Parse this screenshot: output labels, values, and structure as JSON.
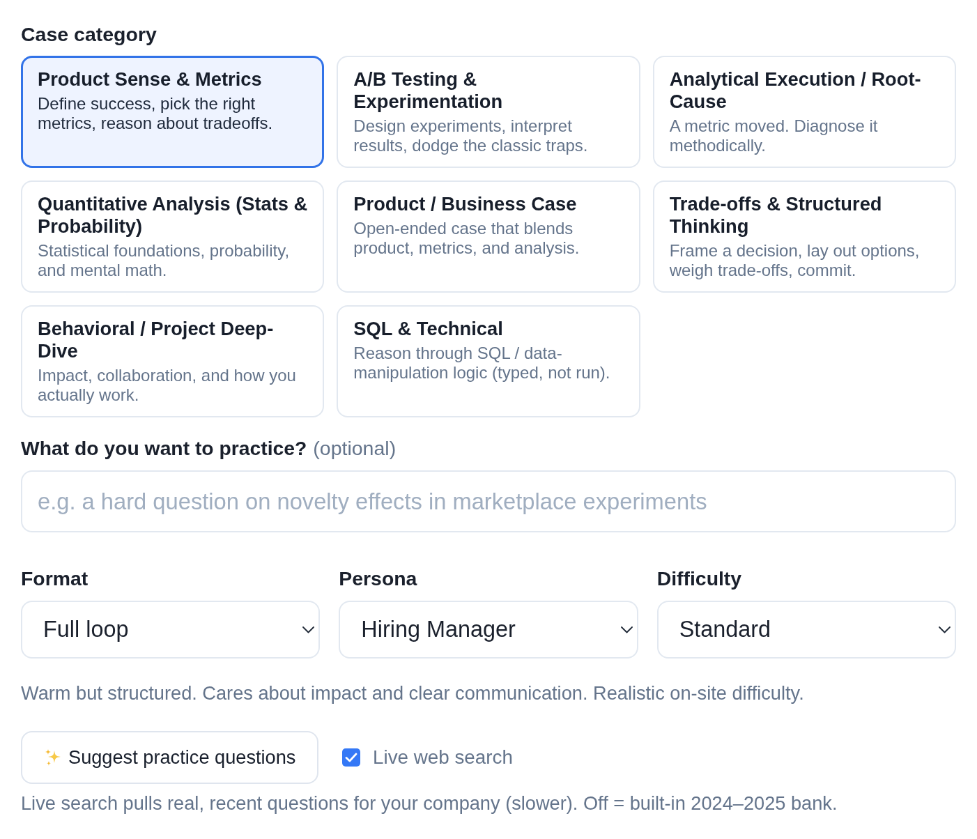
{
  "case_category": {
    "label": "Case category",
    "cards": [
      {
        "title": "Product Sense & Metrics",
        "description": "Define success, pick the right metrics, reason about tradeoffs.",
        "selected": true
      },
      {
        "title": "A/B Testing & Experimentation",
        "description": "Design experiments, interpret results, dodge the classic traps.",
        "selected": false
      },
      {
        "title": "Analytical Execution / Root-Cause",
        "description": "A metric moved. Diagnose it methodically.",
        "selected": false
      },
      {
        "title": "Quantitative Analysis (Stats & Probability)",
        "description": "Statistical foundations, probability, and mental math.",
        "selected": false
      },
      {
        "title": "Product / Business Case",
        "description": "Open-ended case that blends product, metrics, and analysis.",
        "selected": false
      },
      {
        "title": "Trade-offs & Structured Thinking",
        "description": "Frame a decision, lay out options, weigh trade-offs, commit.",
        "selected": false
      },
      {
        "title": "Behavioral / Project Deep-Dive",
        "description": "Impact, collaboration, and how you actually work.",
        "selected": false
      },
      {
        "title": "SQL & Technical",
        "description": "Reason through SQL / data-manipulation logic (typed, not run).",
        "selected": false
      }
    ]
  },
  "practice": {
    "label": "What do you want to practice?",
    "hint": "(optional)",
    "placeholder": "e.g. a hard question on novelty effects in marketplace experiments"
  },
  "selects": [
    {
      "label": "Format",
      "value": "Full loop"
    },
    {
      "label": "Persona",
      "value": "Hiring Manager"
    },
    {
      "label": "Difficulty",
      "value": "Standard"
    }
  ],
  "persona_description": "Warm but structured. Cares about impact and clear communication. Realistic on-site difficulty.",
  "suggest_button": {
    "label": "Suggest practice questions"
  },
  "live_search": {
    "label": "Live web search",
    "checked": true
  },
  "footnote": "Live search pulls real, recent questions for your company (slower). Off = built-in 2024–2025 bank."
}
